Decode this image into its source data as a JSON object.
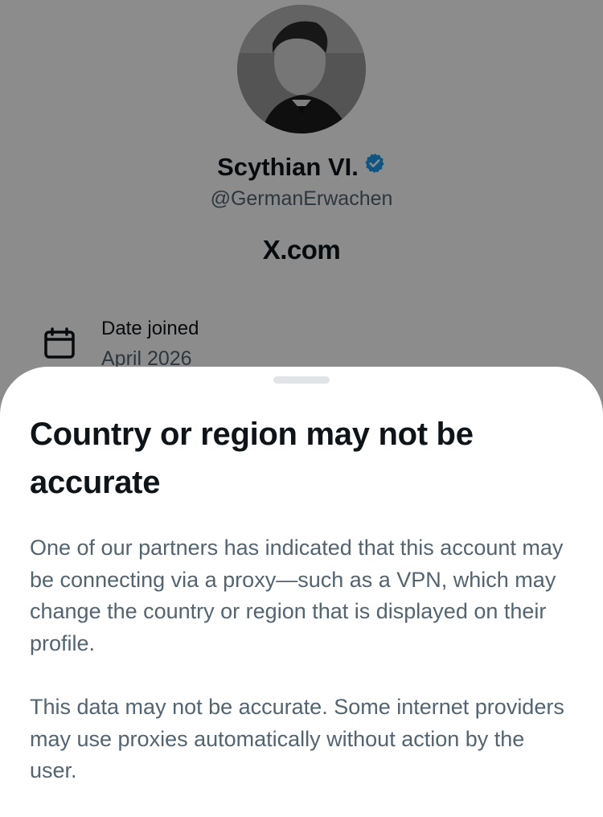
{
  "profile": {
    "display_name": "Scythian VI.",
    "handle": "@GermanErwachen",
    "website": "X.com",
    "date_joined_label": "Date joined",
    "date_joined_value": "April 2026",
    "verified_icon": "verified-badge-icon",
    "calendar_icon": "calendar-icon"
  },
  "sheet": {
    "title": "Country or region may not be accurate",
    "paragraph_1": "One of our partners has indicated that this account may be connecting via a proxy—such as a VPN, which may change the country or region that is displayed on their profile.",
    "paragraph_2": "This data may not be accurate. Some internet providers may use proxies automatically without action by the user."
  },
  "colors": {
    "verified_blue": "#1d9bf0",
    "text_primary": "#0f1419",
    "text_secondary": "#536471",
    "overlay": "rgba(0,0,0,0.45)"
  }
}
